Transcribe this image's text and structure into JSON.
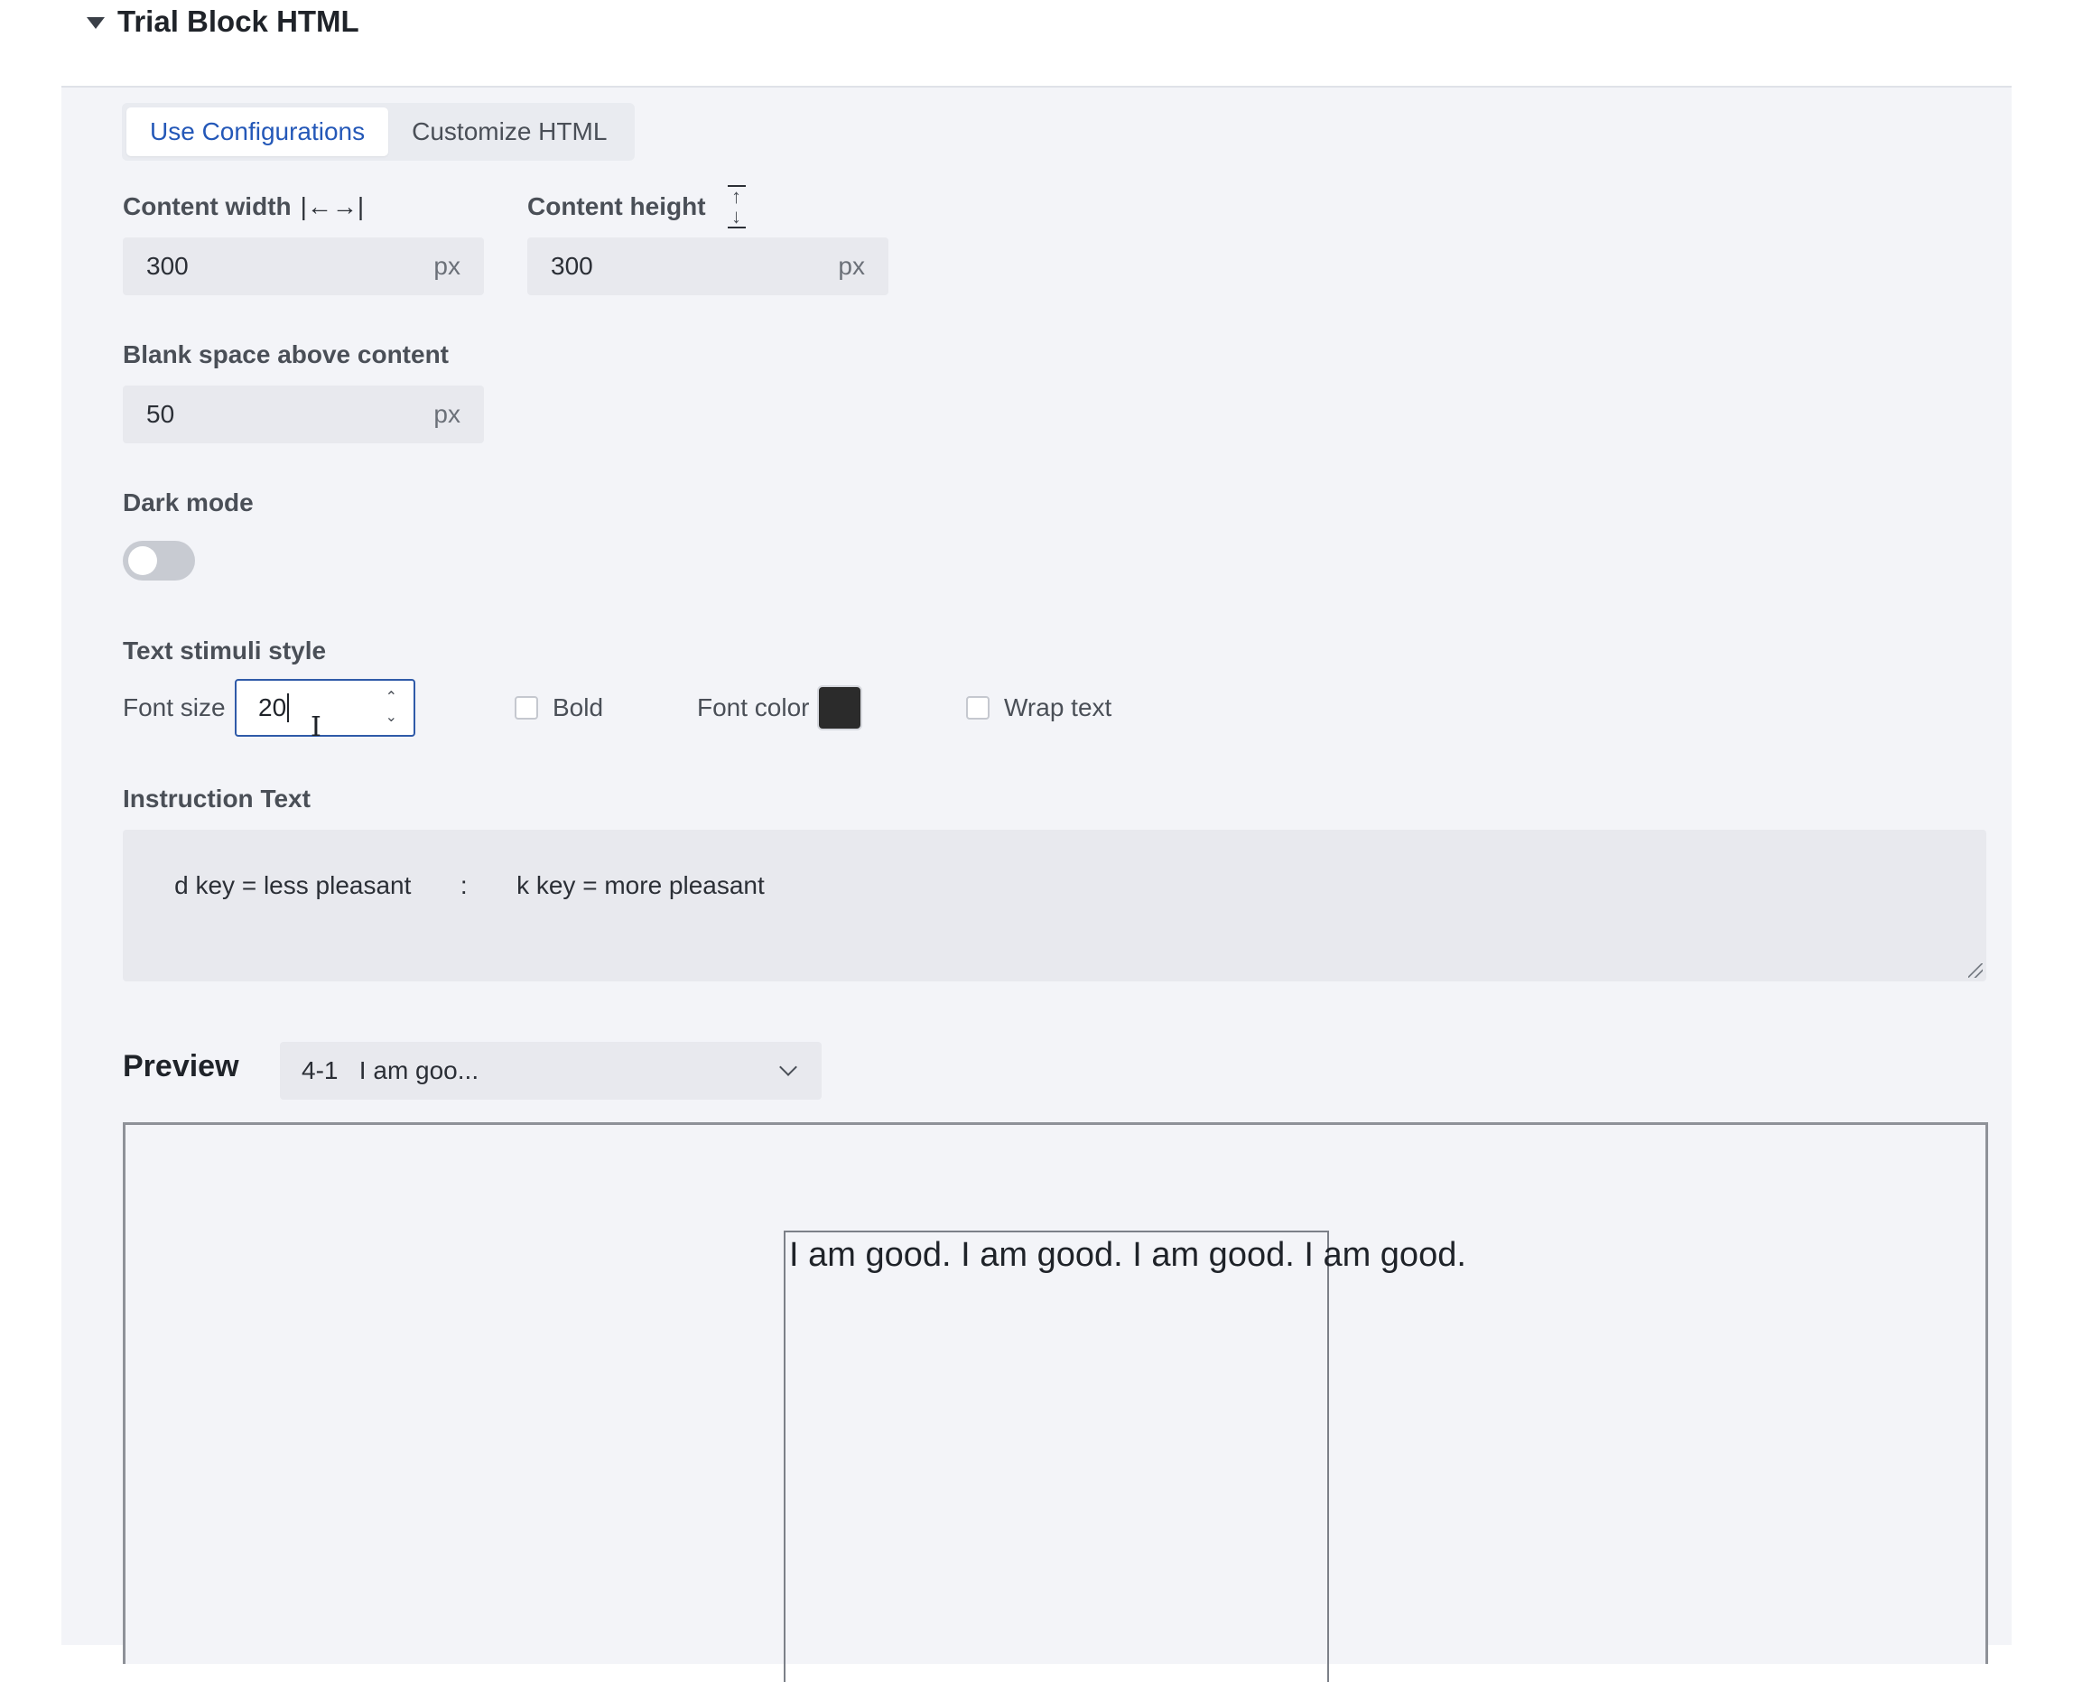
{
  "section": {
    "title": "Trial Block HTML"
  },
  "tabs": [
    {
      "label": "Use Configurations",
      "active": true
    },
    {
      "label": "Customize HTML",
      "active": false
    }
  ],
  "content_width": {
    "label": "Content width",
    "icon": "horizontal-width-icon",
    "icon_glyph": "|←→|",
    "value": "300",
    "unit": "px"
  },
  "content_height": {
    "label": "Content height",
    "icon": "vertical-height-icon",
    "value": "300",
    "unit": "px"
  },
  "blank_space": {
    "label": "Blank space above content",
    "value": "50",
    "unit": "px"
  },
  "dark_mode": {
    "label": "Dark mode",
    "enabled": false
  },
  "text_style": {
    "label": "Text stimuli style",
    "font_size_label": "Font size",
    "font_size_value": "20",
    "bold_label": "Bold",
    "bold_checked": false,
    "font_color_label": "Font color",
    "font_color": "#2b2b2b",
    "wrap_label": "Wrap text",
    "wrap_checked": false
  },
  "instruction": {
    "label": "Instruction Text",
    "value": "d key = less pleasant       :       k key = more pleasant"
  },
  "preview": {
    "title": "Preview",
    "selected": "4-1   I am goo...",
    "stimulus_text": "I am good. I am good. I am good. I am good."
  },
  "colors": {
    "accent": "#2458b8",
    "panel_bg": "#f3f4f8",
    "field_bg": "#e8e9ee"
  }
}
